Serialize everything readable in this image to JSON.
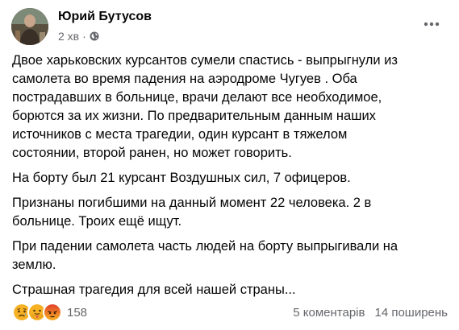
{
  "post": {
    "author": "Юрий Бутусов",
    "time": "2 хв",
    "separator": "·",
    "paragraphs": [
      "Двое харьковских курсантов сумели спастись - выпрыгнули из\nсамолета во время падения на аэродроме Чугуев . Оба\nпострадавших в больнице, врачи делают все необходимое,\nборются за их жизни. По предварительным данным наших\nисточников с места трагедии, один курсант в тяжелом\nсостоянии, второй ранен, но может говорить.",
      "На борту был 21 курсант Воздушных сил, 7 офицеров.",
      "Признаны погибшими на данный момент 22 человека. 2 в\nбольнице. Троих ещё ищут.",
      "При падении самолета часть людей на борту выпрыгивали на\nземлю.",
      "Страшная трагедия для всей нашей страны..."
    ],
    "reactions": {
      "icons": [
        "sad-icon",
        "care-icon",
        "angry-icon"
      ],
      "count": "158"
    },
    "comments_label": "5 коментарів",
    "shares_label": "14 поширень"
  },
  "colors": {
    "secondary_text": "#65676b",
    "primary_text": "#050505",
    "reaction_yellow": "#f7b125",
    "reaction_angry": "#e9710f"
  }
}
